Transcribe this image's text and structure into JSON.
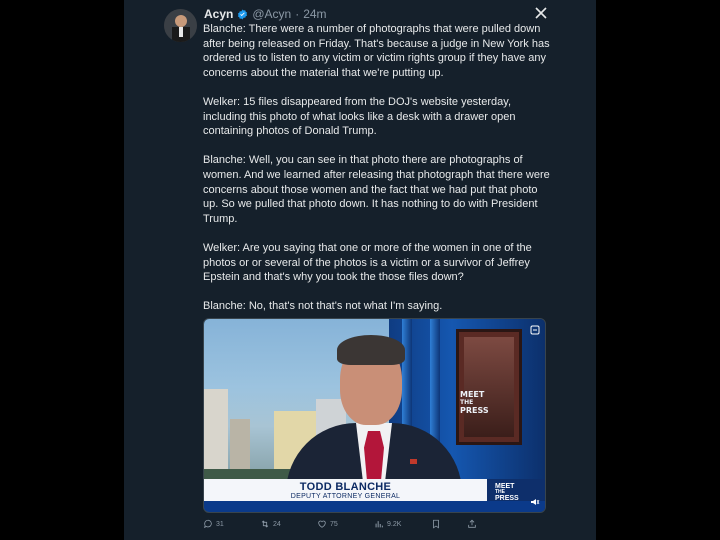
{
  "author": {
    "name": "Acyn",
    "handle": "@Acyn",
    "separator": "·",
    "time": "24m"
  },
  "tweet": {
    "paragraphs": [
      "Blanche: There were a number of photographs that were pulled down after being released on Friday. That's because a judge in New York has ordered us to listen to any victim or victim rights group if they have any concerns about the material that we're putting up.",
      "Welker: 15 files disappeared from the DOJ's website yesterday, including this photo of what looks like a desk with a drawer open containing photos of Donald Trump.",
      "Blanche: Well, you can see in that photo there are photographs of women. And we learned after releasing that photograph that there were concerns about those women and the fact that we had put that photo up. So we pulled that photo down. It has nothing to do with President Trump.",
      "Welker: Are you saying that one or more of the women in one of the photos or or several of the photos is a victim or a survivor of Jeffrey Epstein and that's why you took the those files down?",
      "Blanche: No, that's not that's not what I'm saying."
    ]
  },
  "media": {
    "lower_third_name": "TODD BLANCHE",
    "lower_third_title": "DEPUTY ATTORNEY GENERAL",
    "logo_line1": "MEET",
    "logo_line2": "THE",
    "logo_line3": "PRESS",
    "frame_line1": "MEET",
    "frame_line2": "THE",
    "frame_line3": "PRESS"
  },
  "actions": {
    "replies": "31",
    "reposts": "24",
    "likes": "75",
    "views": "9.2K"
  },
  "icons": [
    "verified-badge-icon",
    "close-icon",
    "media-corner-icon",
    "reply-icon",
    "repost-icon",
    "like-icon",
    "views-icon",
    "bookmark-icon",
    "share-icon"
  ],
  "colors": {
    "background": "#15202b",
    "accent": "#1d9bf0",
    "muted": "#8b98a5"
  }
}
